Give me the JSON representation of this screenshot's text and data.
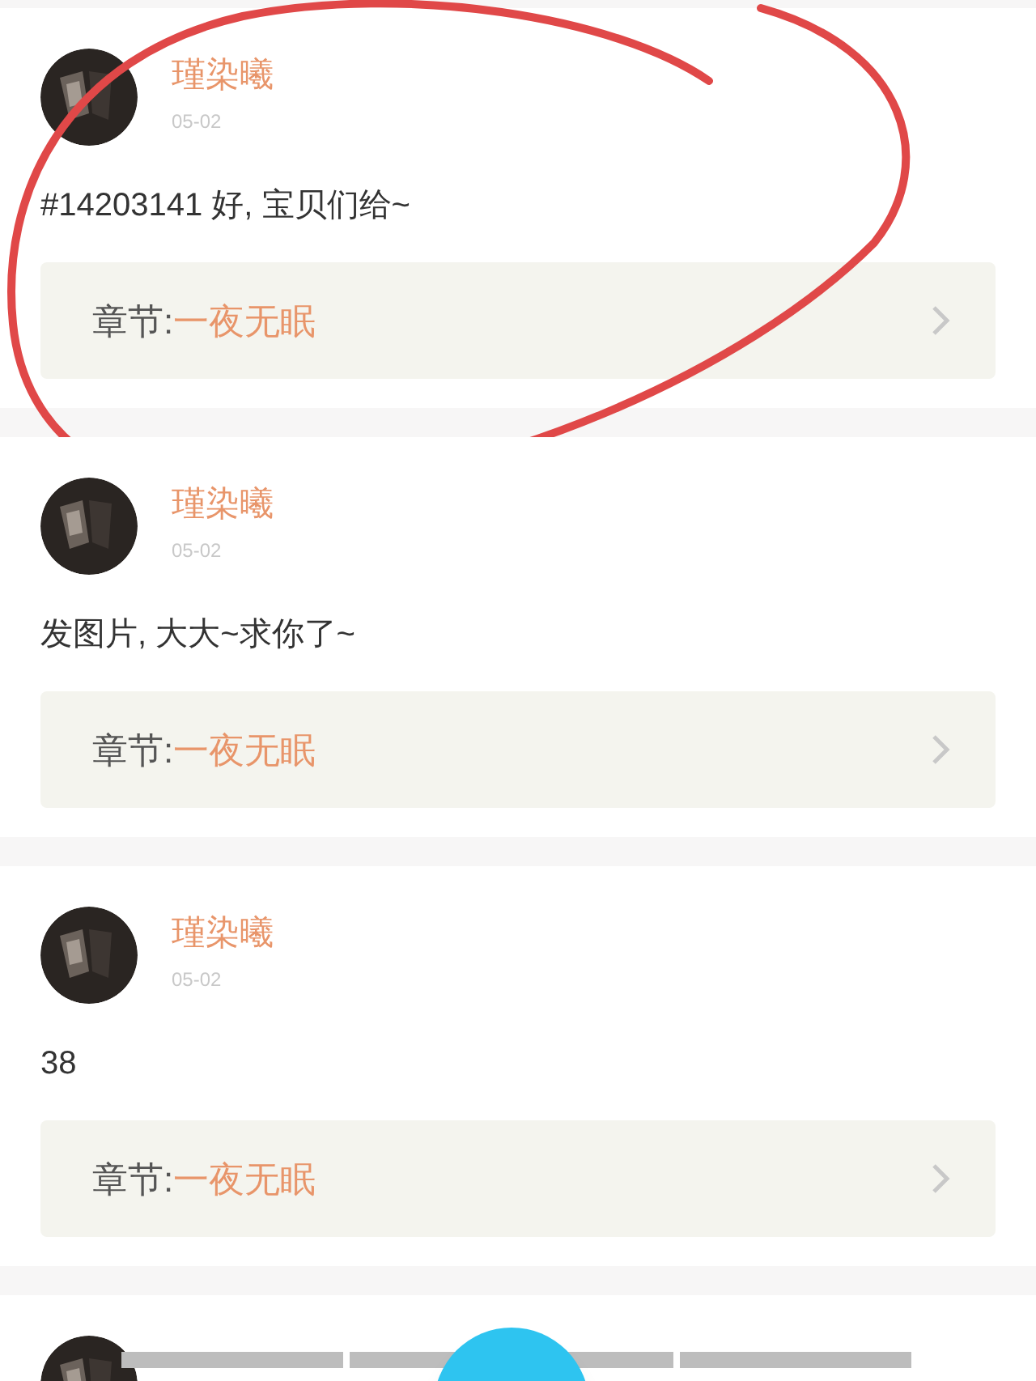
{
  "comments": [
    {
      "name": "瑾染曦",
      "date": "05-02",
      "text": "#14203141 好, 宝贝们给~",
      "chapter_label": "章节:",
      "chapter_title": "一夜无眠",
      "circled": true
    },
    {
      "name": "瑾染曦",
      "date": "05-02",
      "text": "发图片, 大大~求你了~",
      "chapter_label": "章节:",
      "chapter_title": "一夜无眠",
      "circled": false
    },
    {
      "name": "瑾染曦",
      "date": "05-02",
      "text": "38",
      "chapter_label": "章节:",
      "chapter_title": "一夜无眠",
      "circled": false
    }
  ]
}
